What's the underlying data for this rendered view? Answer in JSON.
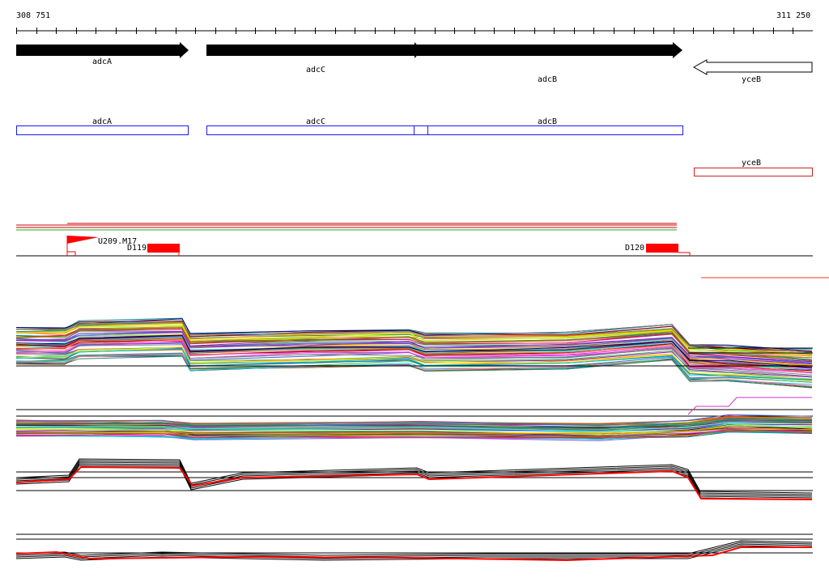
{
  "ruler": {
    "start_label": "308 751",
    "end_label": "311 250"
  },
  "genes": [
    {
      "name": "adcA",
      "strand": "+",
      "fill": "#000000"
    },
    {
      "name": "adcC",
      "strand": "+",
      "fill": "#000000"
    },
    {
      "name": "adcB",
      "strand": "+",
      "fill": "#000000"
    },
    {
      "name": "yceB",
      "strand": "-",
      "fill": "#ffffff"
    }
  ],
  "cds": [
    {
      "name": "adcA",
      "color": "#1a1aff"
    },
    {
      "name": "adcC",
      "color": "#1a1aff"
    },
    {
      "name": "adcB",
      "color": "#1a1aff"
    },
    {
      "name": "yceB",
      "color": "#cc2222"
    }
  ],
  "features": {
    "promoter_label": "U209.M17",
    "segment_1_label": "D119",
    "segment_2_label": "D120",
    "accent_red": "#ff0000"
  },
  "colors": {
    "axis": "#000000",
    "background": "#ffffff"
  }
}
